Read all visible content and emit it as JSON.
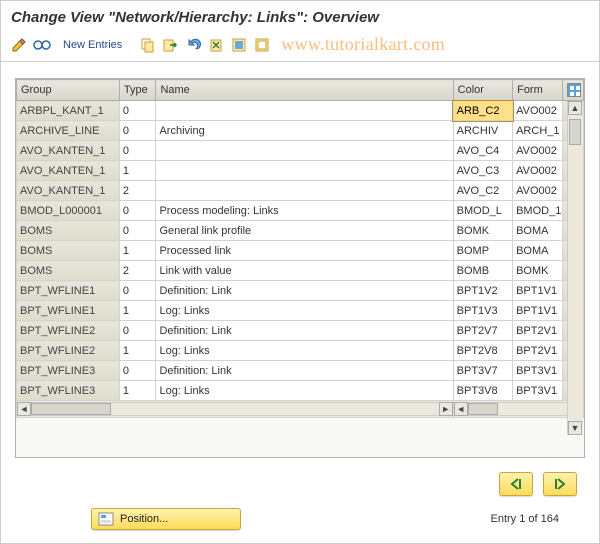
{
  "title": "Change View \"Network/Hierarchy: Links\": Overview",
  "toolbar": {
    "new_entries": "New Entries"
  },
  "watermark": "www.tutorialkart.com",
  "columns": {
    "group": "Group",
    "type": "Type",
    "name": "Name",
    "color": "Color",
    "form": "Form"
  },
  "rows": [
    {
      "group": "ARBPL_KANT_1",
      "type": "0",
      "name": "",
      "color": "ARB_C2",
      "form": "AVO002",
      "selected": true
    },
    {
      "group": "ARCHIVE_LINE",
      "type": "0",
      "name": "Archiving",
      "color": "ARCHIV",
      "form": "ARCH_1"
    },
    {
      "group": "AVO_KANTEN_1",
      "type": "0",
      "name": "",
      "color": "AVO_C4",
      "form": "AVO002"
    },
    {
      "group": "AVO_KANTEN_1",
      "type": "1",
      "name": "",
      "color": "AVO_C3",
      "form": "AVO002"
    },
    {
      "group": "AVO_KANTEN_1",
      "type": "2",
      "name": "",
      "color": "AVO_C2",
      "form": "AVO002"
    },
    {
      "group": "BMOD_L000001",
      "type": "0",
      "name": "Process modeling: Links",
      "color": "BMOD_L",
      "form": "BMOD_1"
    },
    {
      "group": "BOMS",
      "type": "0",
      "name": "General link profile",
      "color": "BOMK",
      "form": "BOMA"
    },
    {
      "group": "BOMS",
      "type": "1",
      "name": "Processed link",
      "color": "BOMP",
      "form": "BOMA"
    },
    {
      "group": "BOMS",
      "type": "2",
      "name": "Link with value",
      "color": "BOMB",
      "form": "BOMK"
    },
    {
      "group": "BPT_WFLINE1",
      "type": "0",
      "name": "Definition: Link",
      "color": "BPT1V2",
      "form": "BPT1V1"
    },
    {
      "group": "BPT_WFLINE1",
      "type": "1",
      "name": "Log: Links",
      "color": "BPT1V3",
      "form": "BPT1V1"
    },
    {
      "group": "BPT_WFLINE2",
      "type": "0",
      "name": "Definition: Link",
      "color": "BPT2V7",
      "form": "BPT2V1"
    },
    {
      "group": "BPT_WFLINE2",
      "type": "1",
      "name": "Log: Links",
      "color": "BPT2V8",
      "form": "BPT2V1"
    },
    {
      "group": "BPT_WFLINE3",
      "type": "0",
      "name": "Definition: Link",
      "color": "BPT3V7",
      "form": "BPT3V1"
    },
    {
      "group": "BPT_WFLINE3",
      "type": "1",
      "name": "Log: Links",
      "color": "BPT3V8",
      "form": "BPT3V1"
    }
  ],
  "position_button": "Position...",
  "entry_status": "Entry 1 of 164"
}
